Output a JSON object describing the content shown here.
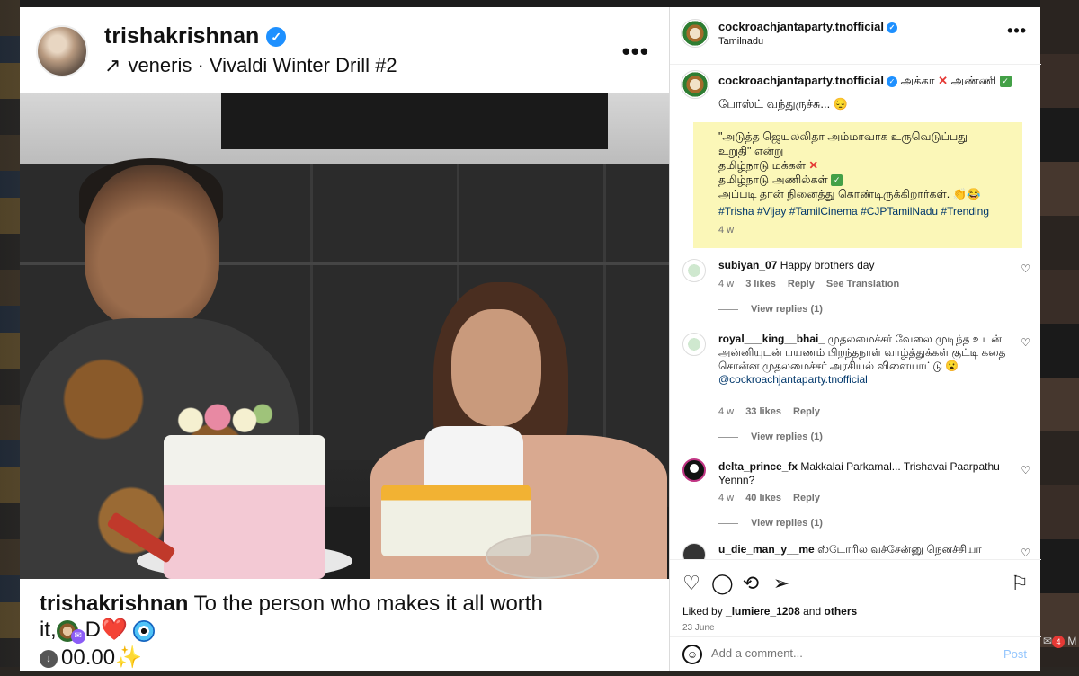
{
  "post": {
    "username": "trishakrishnan",
    "audio": "veneris · Vivaldi Winter Drill #2",
    "caption_user": "trishakrishnan",
    "caption_text": "To the person who makes it all worth",
    "caption_line2": "it,",
    "caption_line2_tail": "D",
    "caption_line3": "00.00"
  },
  "panel": {
    "account": "cockroachjantaparty.tnofficial",
    "location": "Tamilnadu",
    "caption_head_user": "cockroachjantaparty.tnofficial",
    "caption_head_a": "அக்கா",
    "caption_head_b": "அண்ணி",
    "caption_sub": "போஸ்ட் வந்துருச்சு... 😔",
    "highlight_lines": [
      "\"அடுத்த ஜெயலலிதா அம்மாவாக உருவெடுப்பது",
      "உறுதி\" என்று",
      "தமிழ்நாடு மக்கள்",
      "தமிழ்நாடு அணில்கள்",
      "அப்படி தான் நினைத்து கொண்டிருக்கிறார்கள். 👏😂"
    ],
    "hashtags": "#Trisha #Vijay #TamilCinema #CJPTamilNadu #Trending",
    "caption_time": "4 w",
    "comments": [
      {
        "user": "subiyan_07",
        "text": "Happy brothers day",
        "time": "4 w",
        "likes": "3 likes",
        "reply": "Reply",
        "translate": "See Translation",
        "view_replies": "View replies (1)"
      },
      {
        "user": "royal___king__bhai_",
        "text": "முதலமைச்சர் வேலை முடிந்த உடன் அன்னியுடன் பயணம் பிறந்தநாள் வாழ்த்துக்கள் குட்டி கதை சொன்ன முதலமைச்சர் அரசியல் விளையாட்டு 😮",
        "mention": "@cockroachjantaparty.tnofficial",
        "time": "4 w",
        "likes": "33 likes",
        "reply": "Reply",
        "view_replies": "View replies (1)"
      },
      {
        "user": "delta_prince_fx",
        "text": "Makkalai Parkamal... Trishavai Paarpathu Yennn?",
        "time": "4 w",
        "likes": "40 likes",
        "reply": "Reply",
        "view_replies": "View replies (1)"
      },
      {
        "user": "u_die_man_y__me",
        "text": "ஸ்டோரில வச்சேன்னு நெனச்சியா"
      }
    ],
    "liked_by_prefix": "Liked by",
    "liked_by_user": "_lumiere_1208",
    "liked_by_and": "and",
    "liked_by_others": "others",
    "date": "23 June",
    "add_comment_placeholder": "Add a comment...",
    "post_label": "Post"
  },
  "icons": {
    "heart": "heart-icon",
    "comment": "comment-icon",
    "share": "share-icon",
    "send": "send-icon",
    "save": "bookmark-icon"
  },
  "colors": {
    "accent_blue": "#1e90ff",
    "highlight": "#fbf7b8",
    "link": "#00376b"
  },
  "overlay": {
    "messages_label": "M",
    "notif_count": "4"
  }
}
